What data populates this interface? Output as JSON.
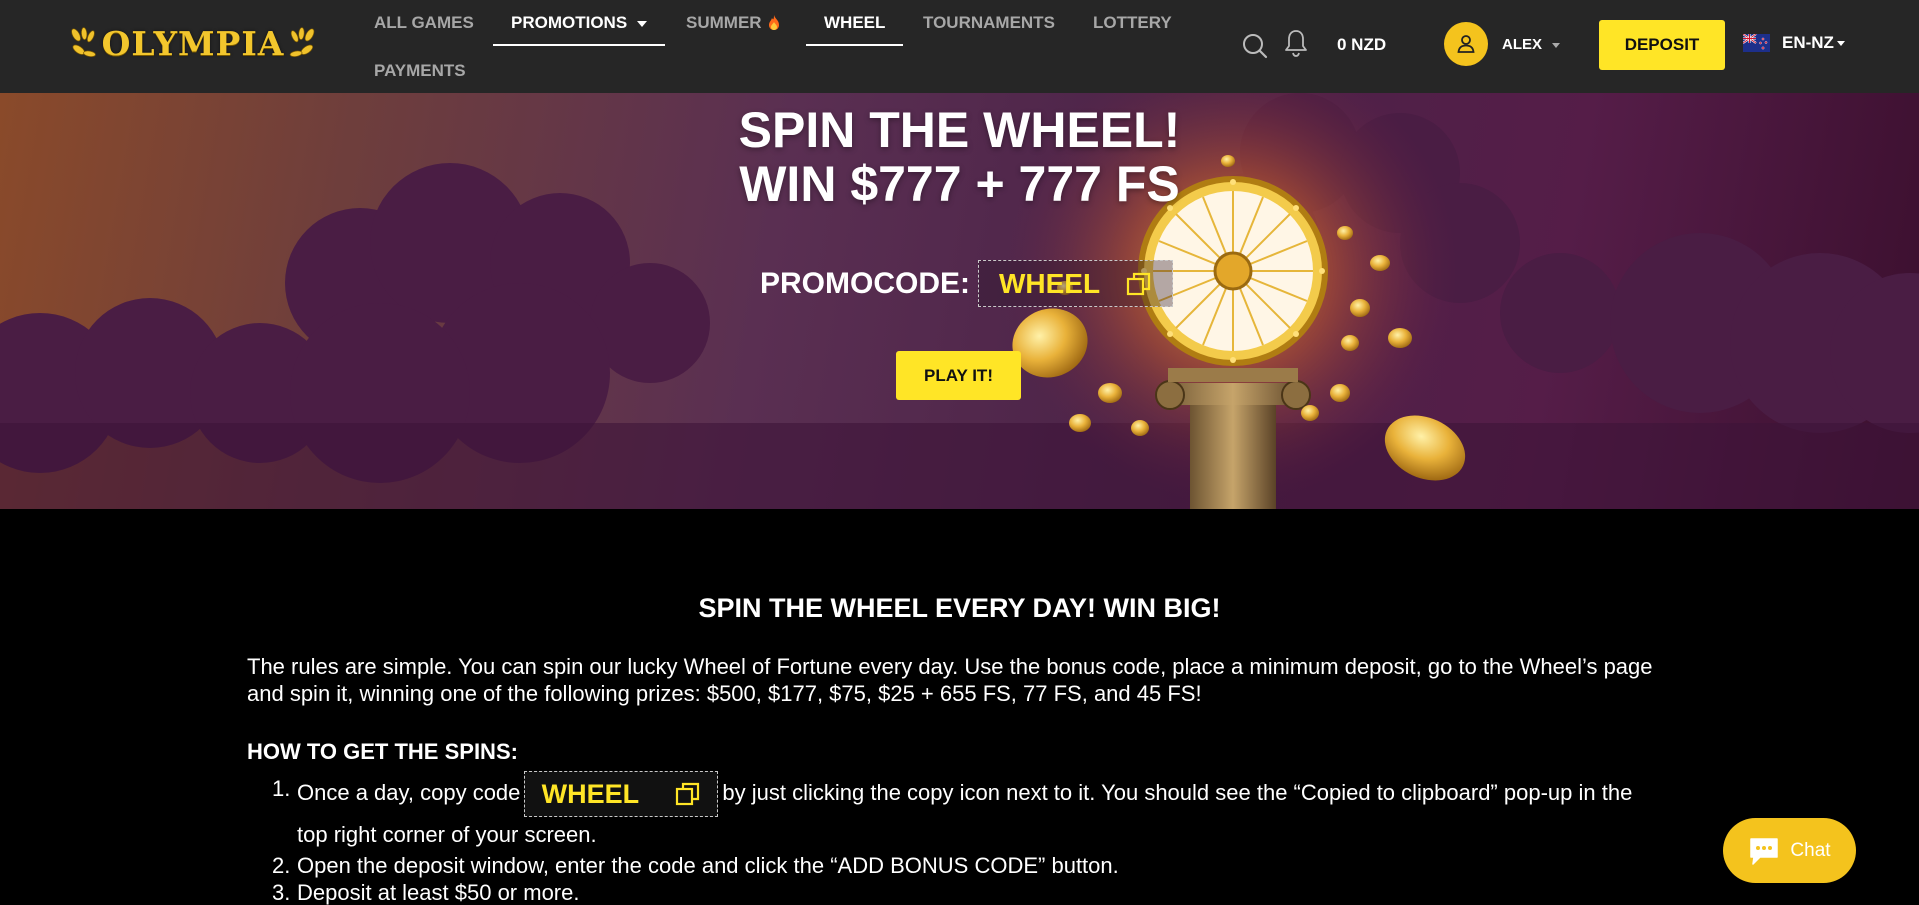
{
  "brand": {
    "name": "OLYMPIA"
  },
  "nav": {
    "items": [
      {
        "label": "ALL GAMES"
      },
      {
        "label": "PROMOTIONS"
      },
      {
        "label": "SUMMER"
      },
      {
        "label": "WHEEL"
      },
      {
        "label": "TOURNAMENTS"
      },
      {
        "label": "LOTTERY"
      },
      {
        "label": "PAYMENTS"
      }
    ]
  },
  "header": {
    "search_icon": "search-icon",
    "bell_icon": "bell-icon",
    "balance": "0 NZD",
    "username": "ALEX",
    "deposit_label": "DEPOSIT",
    "language": "EN-NZ",
    "flag": "new-zealand-flag"
  },
  "hero": {
    "title_line1": "SPIN THE WHEEL!",
    "title_line2": "WIN $777 + 777 FS",
    "promo_label": "PROMOCODE:",
    "promo_code": "WHEEL",
    "play_label": "PLAY IT!"
  },
  "content": {
    "heading": "SPIN THE WHEEL EVERY DAY! WIN BIG!",
    "intro": "The rules are simple. You can spin our lucky Wheel of Fortune every day. Use the bonus code, place a minimum deposit, go to the Wheel’s page and spin it, winning one of the following prizes: $500, $177, $75, $25 + 655 FS, 77 FS, and 45 FS!",
    "how_title": "HOW TO GET THE SPINS:",
    "steps": [
      {
        "num": "1.",
        "before": "Once a day, copy code",
        "code": "WHEEL",
        "after": "by just clicking the copy icon next to it. You should see the “Copied to clipboard” pop-up in the top right corner of your screen."
      },
      {
        "num": "2.",
        "text": "Open the deposit window, enter the code and click the “ADD BONUS CODE” button."
      },
      {
        "num": "3.",
        "text": "Deposit at least $50 or more."
      }
    ]
  },
  "chat": {
    "label": "Chat"
  },
  "colors": {
    "accent": "#ffe526",
    "header_bg": "#262626",
    "avatar": "#f4c31d"
  }
}
